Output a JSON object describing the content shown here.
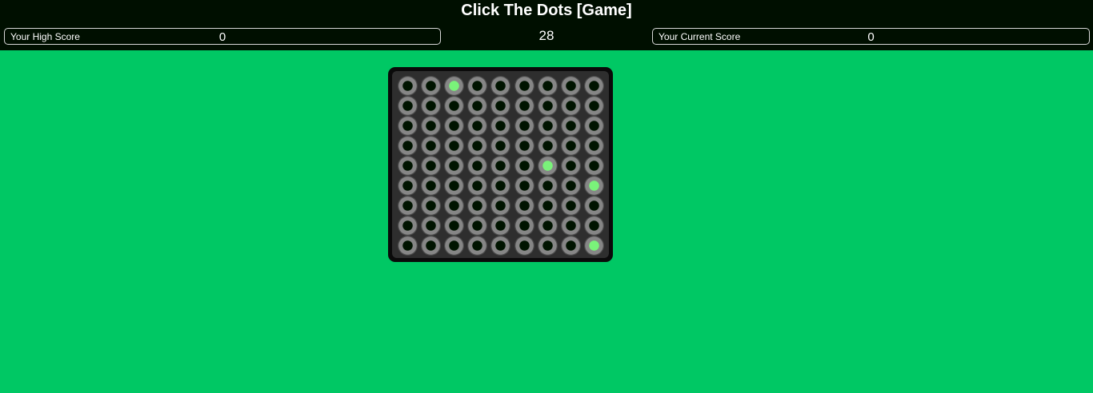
{
  "game": {
    "title": "Click The Dots [Game]",
    "high_score_label": "Your High Score",
    "high_score_value": "0",
    "timer": "28",
    "current_score_label": "Your Current Score",
    "current_score_value": "0"
  },
  "board": {
    "rows": 9,
    "cols": 9,
    "lit_dots": [
      {
        "row": 1,
        "col": 3
      },
      {
        "row": 5,
        "col": 7
      },
      {
        "row": 6,
        "col": 9
      },
      {
        "row": 9,
        "col": 9
      }
    ]
  },
  "colors": {
    "background": "#00c864",
    "header": "#000f00",
    "lit_dot": "#7af27a",
    "unlit_dot": "#001400"
  }
}
